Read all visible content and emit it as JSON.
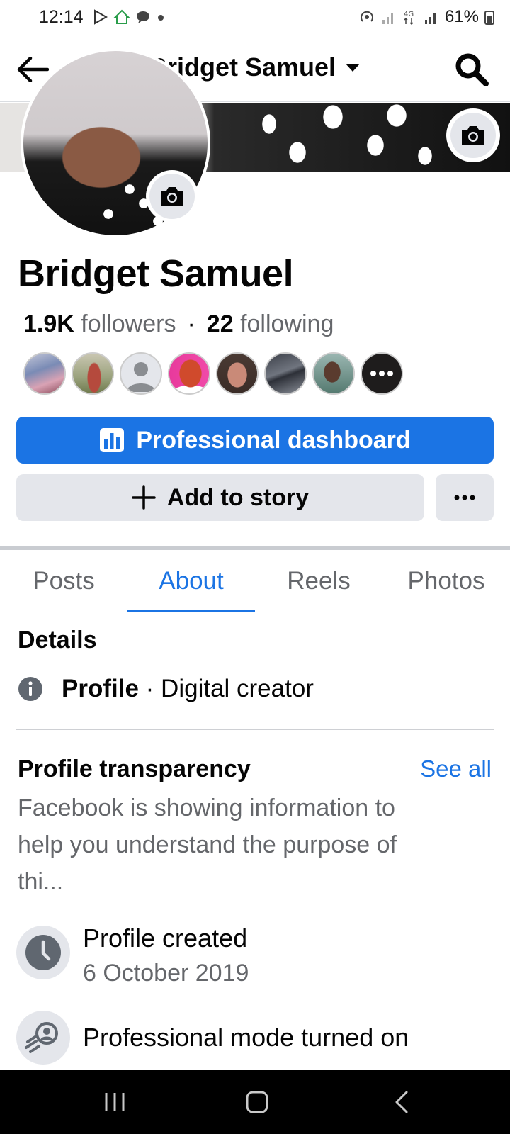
{
  "status_bar": {
    "time": "12:14",
    "battery": "61%"
  },
  "header": {
    "title": "Bridget Samuel"
  },
  "profile": {
    "name": "Bridget Samuel",
    "followers_count": "1.9K",
    "followers_label": "followers",
    "separator": "·",
    "following_count": "22",
    "following_label": "following"
  },
  "actions": {
    "primary_label": "Professional dashboard",
    "secondary_label": "Add to story"
  },
  "tabs": [
    {
      "label": "Posts",
      "active": false
    },
    {
      "label": "About",
      "active": true
    },
    {
      "label": "Reels",
      "active": false
    },
    {
      "label": "Photos",
      "active": false
    }
  ],
  "details": {
    "title": "Details",
    "label": "Profile",
    "separator": "·",
    "value": "Digital creator"
  },
  "transparency": {
    "title": "Profile transparency",
    "see_all": "See all",
    "description": "Facebook is showing information to help you understand the purpose of thi...",
    "items": [
      {
        "label": "Profile created",
        "value": "6 October 2019",
        "icon": "clock-icon"
      },
      {
        "label": "Professional mode turned on",
        "value": "",
        "icon": "professional-mode-icon"
      }
    ]
  },
  "colors": {
    "accent": "#1b74e4",
    "secondary_bg": "#e4e6eb",
    "muted_text": "#65676b"
  }
}
